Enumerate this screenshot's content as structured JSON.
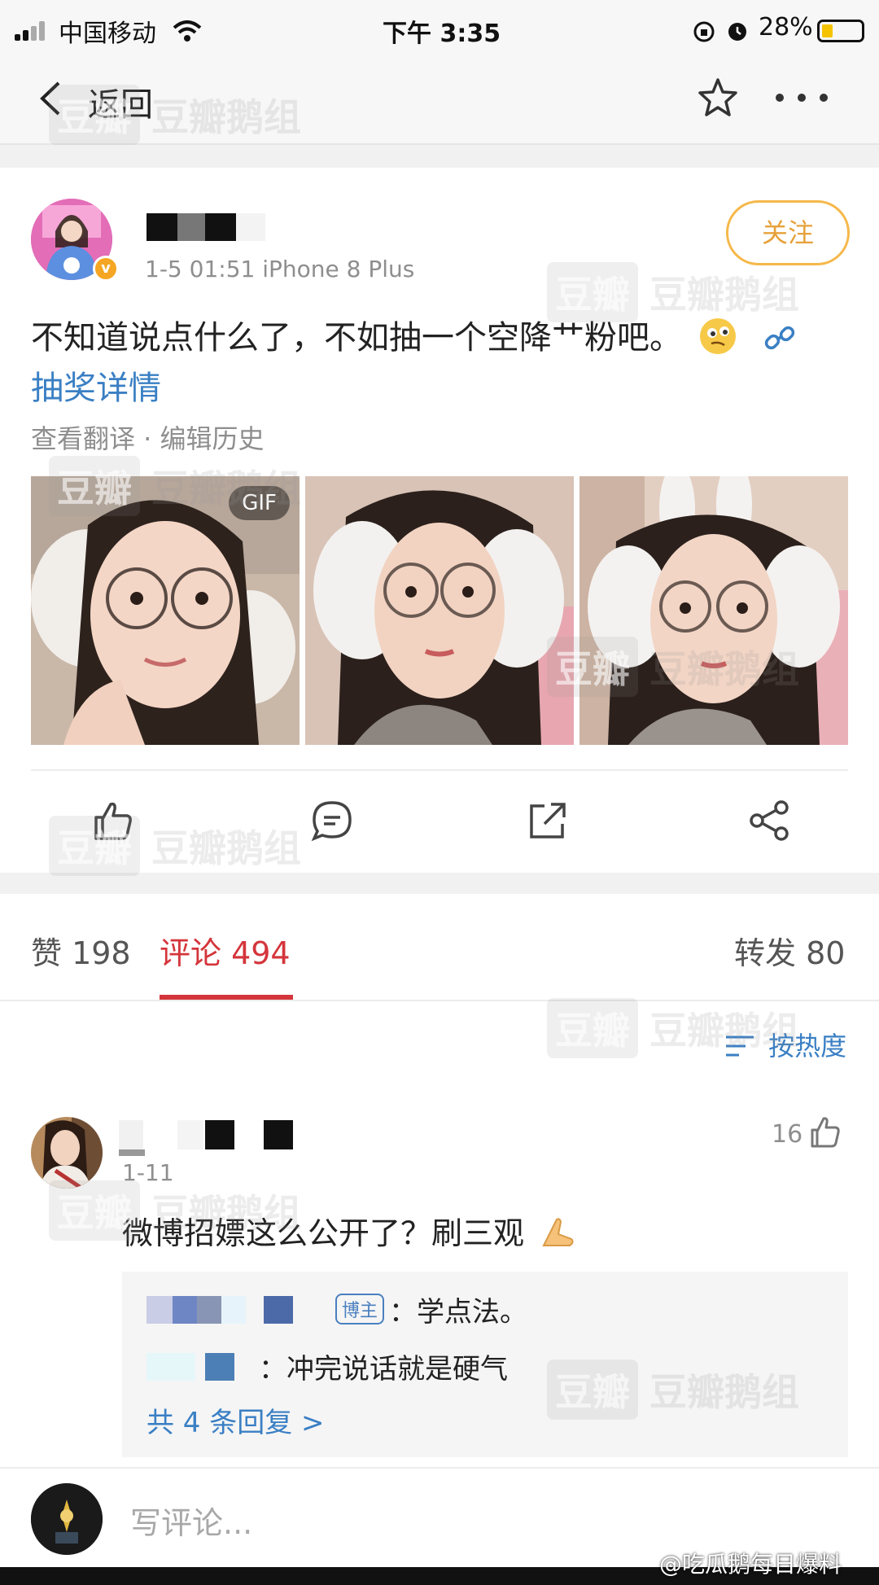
{
  "status_bar": {
    "carrier": "中国移动",
    "time": "下午 3:35",
    "battery": "28%"
  },
  "nav": {
    "back_label": "返回"
  },
  "post": {
    "meta": "1-5 01:51 iPhone 8 Plus",
    "follow_label": "关注",
    "text": "不知道说点什么了，不如抽一个空降艹粉吧。",
    "link_text": "抽奖详情",
    "sub_actions": "查看翻译 · 编辑历史",
    "gif_badge": "GIF"
  },
  "tabs": {
    "likes": "赞 198",
    "comments": "评论 494",
    "reposts": "转发 80"
  },
  "sort_label": "按热度",
  "comment": {
    "date": "1-11",
    "like_count": "16",
    "text": "微博招嫖这么公开了？刷三观",
    "replies": [
      {
        "badge": "博主",
        "text": "：学点法。"
      },
      {
        "text": "：冲完说话就是硬气"
      }
    ],
    "more_replies": "共 4 条回复 >"
  },
  "compose_placeholder": "写评论...",
  "watermark": {
    "box": "豆瓣",
    "text": "豆瓣鹅组"
  },
  "source_watermark": "@吃瓜鹅每日爆料",
  "colors": {
    "accent_red": "#d4353b",
    "link_blue": "#3a7fc4",
    "follow_orange": "#e6a13a"
  }
}
